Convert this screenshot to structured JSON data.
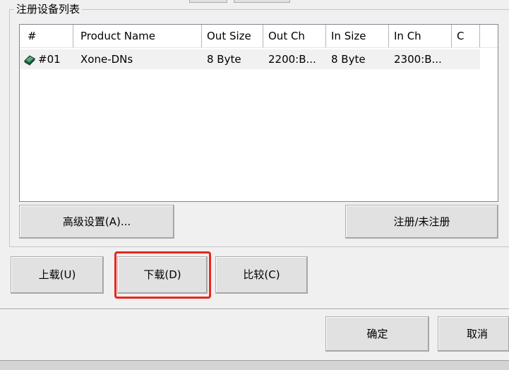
{
  "group": {
    "title": "注册设备列表"
  },
  "table": {
    "columns": [
      "#",
      "Product Name",
      "Out Size",
      "Out Ch",
      "In Size",
      "In Ch",
      "C"
    ],
    "rows": [
      {
        "num": "#01",
        "product": "Xone-DNs",
        "out_size": "8 Byte",
        "out_ch": "2200:B...",
        "in_size": "8 Byte",
        "in_ch": "2300:B...",
        "c": "",
        "icon": "device-icon"
      }
    ]
  },
  "buttons": {
    "advanced": "高级设置(A)...",
    "register": "注册/未注册",
    "upload": "上载(U)",
    "download": "下载(D)",
    "compare": "比较(C)",
    "ok": "确定",
    "cancel": "取消"
  },
  "colors": {
    "highlight": "#e8271f",
    "face": "#f0f0f0",
    "button": "#e1e1e1"
  }
}
